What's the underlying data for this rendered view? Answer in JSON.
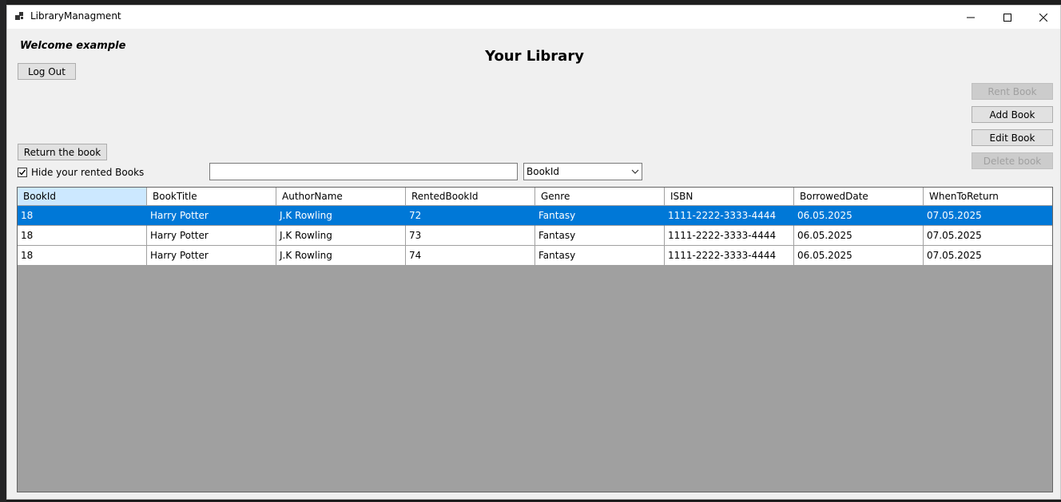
{
  "window": {
    "title": "LibraryManagment"
  },
  "header": {
    "welcome": "Welcome example",
    "heading": "Your Library"
  },
  "buttons": {
    "logout": "Log Out",
    "return_book": "Return the book",
    "rent_book": "Rent Book",
    "add_book": "Add Book",
    "edit_book": "Edit Book",
    "delete_book": "Delete book"
  },
  "filter": {
    "hide_rented_label": "Hide your rented Books",
    "hide_rented_checked": true,
    "search_value": "",
    "search_by_selected": "BookId"
  },
  "table": {
    "columns": [
      "BookId",
      "BookTitle",
      "AuthorName",
      "RentedBookId",
      "Genre",
      "ISBN",
      "BorrowedDate",
      "WhenToReturn"
    ],
    "rows": [
      [
        "18",
        "Harry Potter",
        "J.K Rowling",
        "72",
        "Fantasy",
        "1111-2222-3333-4444",
        "06.05.2025",
        "07.05.2025"
      ],
      [
        "18",
        "Harry Potter",
        "J.K Rowling",
        "73",
        "Fantasy",
        "1111-2222-3333-4444",
        "06.05.2025",
        "07.05.2025"
      ],
      [
        "18",
        "Harry Potter",
        "J.K Rowling",
        "74",
        "Fantasy",
        "1111-2222-3333-4444",
        "06.05.2025",
        "07.05.2025"
      ]
    ],
    "selected_row": 0,
    "selected_column": 0
  },
  "colors": {
    "selection": "#0078d7",
    "header_highlight": "#cce8ff",
    "grid_background": "#a0a0a0"
  }
}
